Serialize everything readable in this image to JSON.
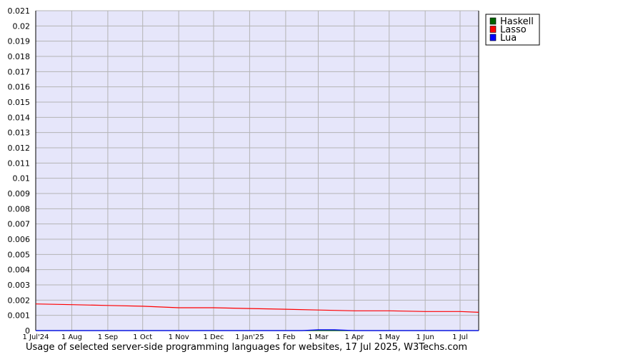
{
  "chart_data": {
    "type": "line",
    "caption": "Usage of selected server-side programming languages for websites, 17 Jul 2025, W3Techs.com",
    "ylim": [
      0,
      0.021
    ],
    "y_ticks": [
      "0",
      "0.001",
      "0.002",
      "0.003",
      "0.004",
      "0.005",
      "0.006",
      "0.007",
      "0.008",
      "0.009",
      "0.01",
      "0.011",
      "0.012",
      "0.013",
      "0.014",
      "0.015",
      "0.016",
      "0.017",
      "0.018",
      "0.019",
      "0.02",
      "0.021"
    ],
    "x_ticks": [
      "1 Jul'24",
      "1 Aug",
      "1 Sep",
      "1 Oct",
      "1 Nov",
      "1 Dec",
      "1 Jan'25",
      "1 Feb",
      "1 Mar",
      "1 Apr",
      "1 May",
      "1 Jun",
      "1 Jul"
    ],
    "x_range": [
      "2024-07-01",
      "2025-07-17"
    ],
    "grid": true,
    "legend_position": "top-right",
    "plot_background": "#e6e6fa",
    "series": [
      {
        "name": "Haskell",
        "color": "#006400",
        "x": [
          "2024-07-01",
          "2025-07-17"
        ],
        "y": [
          0,
          0
        ]
      },
      {
        "name": "Lasso",
        "color": "#ff0000",
        "x": [
          "2024-07-01",
          "2024-08-01",
          "2024-09-01",
          "2024-10-01",
          "2024-11-01",
          "2024-12-01",
          "2025-01-01",
          "2025-02-01",
          "2025-03-01",
          "2025-04-01",
          "2025-05-01",
          "2025-06-01",
          "2025-07-01",
          "2025-07-17"
        ],
        "y": [
          0.00175,
          0.0017,
          0.00165,
          0.0016,
          0.0015,
          0.0015,
          0.00145,
          0.0014,
          0.00135,
          0.0013,
          0.0013,
          0.00125,
          0.00125,
          0.0012
        ]
      },
      {
        "name": "Lua",
        "color": "#0000ff",
        "x": [
          "2024-07-01",
          "2025-02-15",
          "2025-03-01",
          "2025-03-15",
          "2025-04-01",
          "2025-07-17"
        ],
        "y": [
          0,
          0,
          5e-05,
          5e-05,
          0,
          0
        ]
      }
    ]
  }
}
